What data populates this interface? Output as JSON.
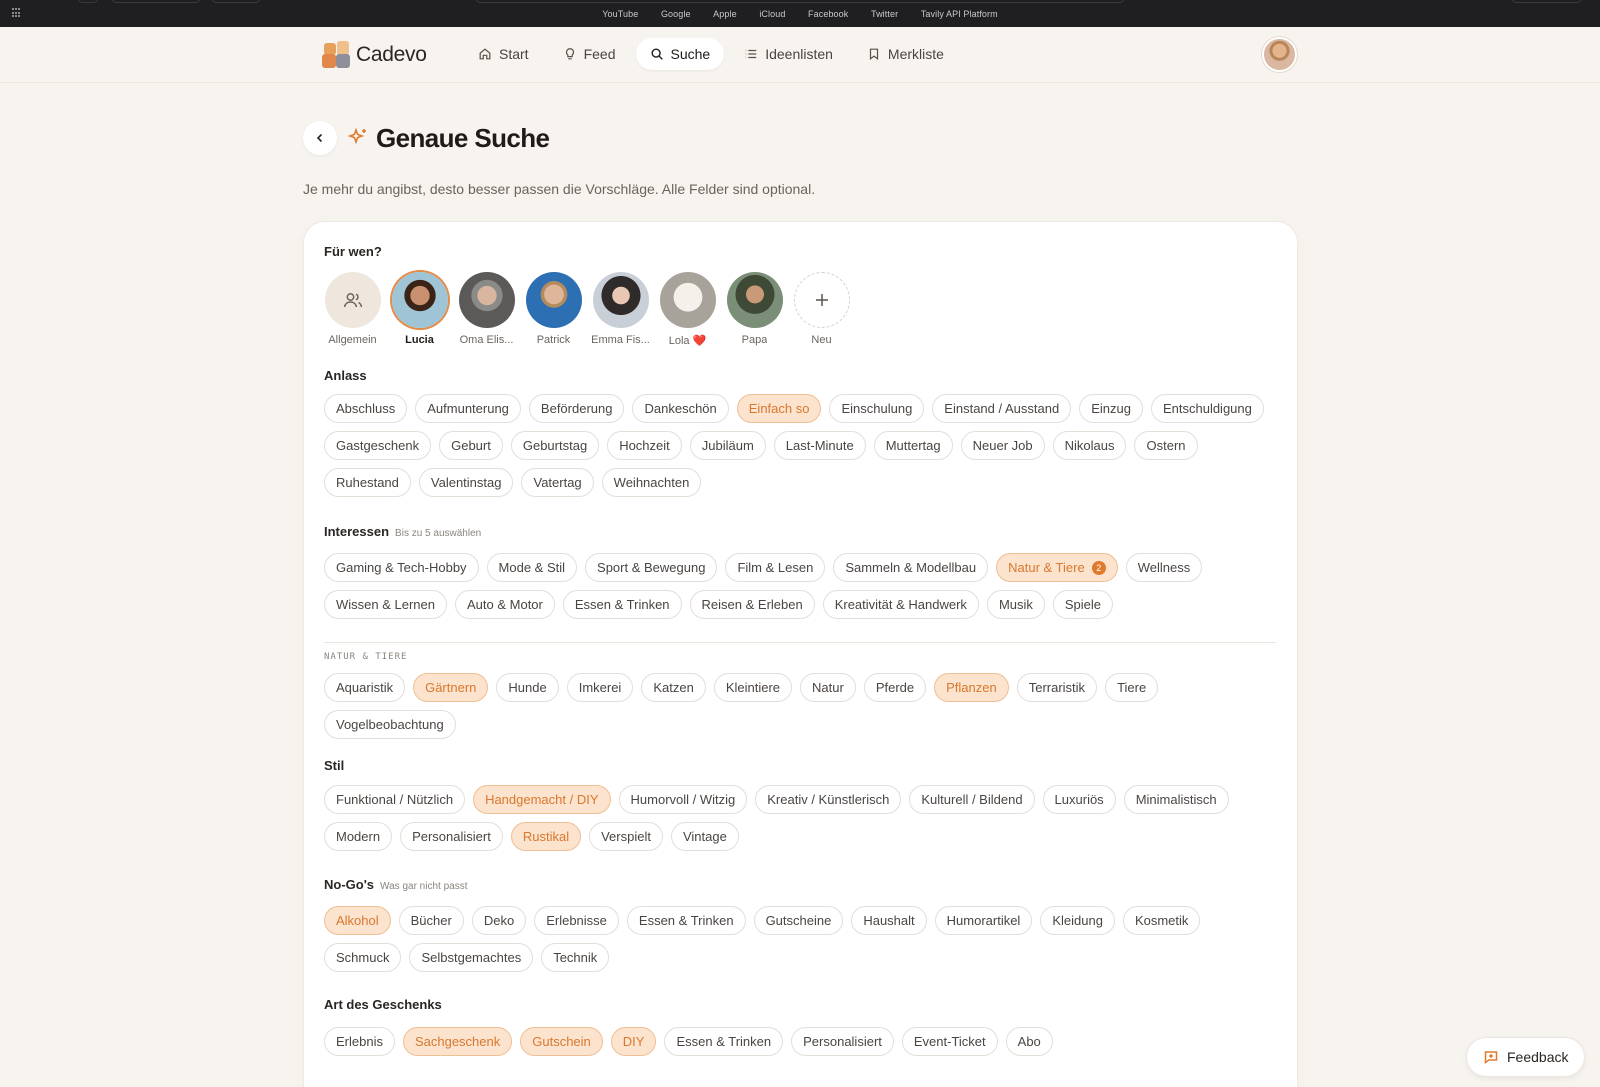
{
  "browser": {
    "bookmarks": [
      "YouTube",
      "Google",
      "Apple",
      "iCloud",
      "Facebook",
      "Twitter",
      "Tavily API Platform"
    ]
  },
  "header": {
    "logo_text": "Cadevo",
    "nav": [
      {
        "label": "Start",
        "icon": "home-icon",
        "active": false
      },
      {
        "label": "Feed",
        "icon": "lightbulb-icon",
        "active": false
      },
      {
        "label": "Suche",
        "icon": "search-icon",
        "active": true
      },
      {
        "label": "Ideenlisten",
        "icon": "list-icon",
        "active": false
      },
      {
        "label": "Merkliste",
        "icon": "bookmark-icon",
        "active": false
      }
    ]
  },
  "page": {
    "title": "Genaue Suche",
    "subtitle": "Je mehr du angibst, desto besser passen die Vorschläge. Alle Felder sind optional."
  },
  "recipients": {
    "label": "Für wen?",
    "people": [
      {
        "name": "Allgemein",
        "active": false
      },
      {
        "name": "Lucia",
        "active": true
      },
      {
        "name": "Oma Elis...",
        "active": false
      },
      {
        "name": "Patrick",
        "active": false
      },
      {
        "name": "Emma Fis...",
        "active": false
      },
      {
        "name": "Lola ❤️",
        "active": false
      },
      {
        "name": "Papa",
        "active": false
      },
      {
        "name": "Neu",
        "active": false
      }
    ]
  },
  "occasion": {
    "label": "Anlass",
    "chips": [
      {
        "label": "Abschluss",
        "selected": false
      },
      {
        "label": "Aufmunterung",
        "selected": false
      },
      {
        "label": "Beförderung",
        "selected": false
      },
      {
        "label": "Dankeschön",
        "selected": false
      },
      {
        "label": "Einfach so",
        "selected": true
      },
      {
        "label": "Einschulung",
        "selected": false
      },
      {
        "label": "Einstand / Ausstand",
        "selected": false
      },
      {
        "label": "Einzug",
        "selected": false
      },
      {
        "label": "Entschuldigung",
        "selected": false
      },
      {
        "label": "Gastgeschenk",
        "selected": false
      },
      {
        "label": "Geburt",
        "selected": false
      },
      {
        "label": "Geburtstag",
        "selected": false
      },
      {
        "label": "Hochzeit",
        "selected": false
      },
      {
        "label": "Jubiläum",
        "selected": false
      },
      {
        "label": "Last-Minute",
        "selected": false
      },
      {
        "label": "Muttertag",
        "selected": false
      },
      {
        "label": "Neuer Job",
        "selected": false
      },
      {
        "label": "Nikolaus",
        "selected": false
      },
      {
        "label": "Ostern",
        "selected": false
      },
      {
        "label": "Ruhestand",
        "selected": false
      },
      {
        "label": "Valentinstag",
        "selected": false
      },
      {
        "label": "Vatertag",
        "selected": false
      },
      {
        "label": "Weihnachten",
        "selected": false
      }
    ]
  },
  "interests": {
    "label": "Interessen",
    "hint": "Bis zu 5 auswählen",
    "chips": [
      {
        "label": "Gaming & Tech-Hobby",
        "selected": false
      },
      {
        "label": "Mode & Stil",
        "selected": false
      },
      {
        "label": "Sport & Bewegung",
        "selected": false
      },
      {
        "label": "Film & Lesen",
        "selected": false
      },
      {
        "label": "Sammeln & Modellbau",
        "selected": false
      },
      {
        "label": "Natur & Tiere",
        "selected": true,
        "count": "2"
      },
      {
        "label": "Wellness",
        "selected": false
      },
      {
        "label": "Wissen & Lernen",
        "selected": false
      },
      {
        "label": "Auto & Motor",
        "selected": false
      },
      {
        "label": "Essen & Trinken",
        "selected": false
      },
      {
        "label": "Reisen & Erleben",
        "selected": false
      },
      {
        "label": "Kreativität & Handwerk",
        "selected": false
      },
      {
        "label": "Musik",
        "selected": false
      },
      {
        "label": "Spiele",
        "selected": false
      }
    ]
  },
  "nature_sub": {
    "label": "NATUR & TIERE",
    "chips": [
      {
        "label": "Aquaristik",
        "selected": false
      },
      {
        "label": "Gärtnern",
        "selected": true
      },
      {
        "label": "Hunde",
        "selected": false
      },
      {
        "label": "Imkerei",
        "selected": false
      },
      {
        "label": "Katzen",
        "selected": false
      },
      {
        "label": "Kleintiere",
        "selected": false
      },
      {
        "label": "Natur",
        "selected": false
      },
      {
        "label": "Pferde",
        "selected": false
      },
      {
        "label": "Pflanzen",
        "selected": true
      },
      {
        "label": "Terraristik",
        "selected": false
      },
      {
        "label": "Tiere",
        "selected": false
      },
      {
        "label": "Vogelbeobachtung",
        "selected": false
      }
    ]
  },
  "style": {
    "label": "Stil",
    "chips": [
      {
        "label": "Funktional / Nützlich",
        "selected": false
      },
      {
        "label": "Handgemacht / DIY",
        "selected": true
      },
      {
        "label": "Humorvoll / Witzig",
        "selected": false
      },
      {
        "label": "Kreativ / Künstlerisch",
        "selected": false
      },
      {
        "label": "Kulturell / Bildend",
        "selected": false
      },
      {
        "label": "Luxuriös",
        "selected": false
      },
      {
        "label": "Minimalistisch",
        "selected": false
      },
      {
        "label": "Modern",
        "selected": false
      },
      {
        "label": "Personalisiert",
        "selected": false
      },
      {
        "label": "Rustikal",
        "selected": true
      },
      {
        "label": "Verspielt",
        "selected": false
      },
      {
        "label": "Vintage",
        "selected": false
      }
    ]
  },
  "nogos": {
    "label": "No-Go's",
    "hint": "Was gar nicht passt",
    "chips": [
      {
        "label": "Alkohol",
        "selected": true
      },
      {
        "label": "Bücher",
        "selected": false
      },
      {
        "label": "Deko",
        "selected": false
      },
      {
        "label": "Erlebnisse",
        "selected": false
      },
      {
        "label": "Essen & Trinken",
        "selected": false
      },
      {
        "label": "Gutscheine",
        "selected": false
      },
      {
        "label": "Haushalt",
        "selected": false
      },
      {
        "label": "Humorartikel",
        "selected": false
      },
      {
        "label": "Kleidung",
        "selected": false
      },
      {
        "label": "Kosmetik",
        "selected": false
      },
      {
        "label": "Schmuck",
        "selected": false
      },
      {
        "label": "Selbstgemachtes",
        "selected": false
      },
      {
        "label": "Technik",
        "selected": false
      }
    ]
  },
  "gift_type": {
    "label": "Art des Geschenks",
    "chips": [
      {
        "label": "Erlebnis",
        "selected": false
      },
      {
        "label": "Sachgeschenk",
        "selected": true
      },
      {
        "label": "Gutschein",
        "selected": true
      },
      {
        "label": "DIY",
        "selected": true
      },
      {
        "label": "Essen & Trinken",
        "selected": false
      },
      {
        "label": "Personalisiert",
        "selected": false
      },
      {
        "label": "Event-Ticket",
        "selected": false
      },
      {
        "label": "Abo",
        "selected": false
      }
    ]
  },
  "feedback": {
    "label": "Feedback"
  },
  "colors": {
    "accent": "#e07b2e",
    "selected_bg": "#fbe3cd",
    "background": "#f7f3ee"
  }
}
